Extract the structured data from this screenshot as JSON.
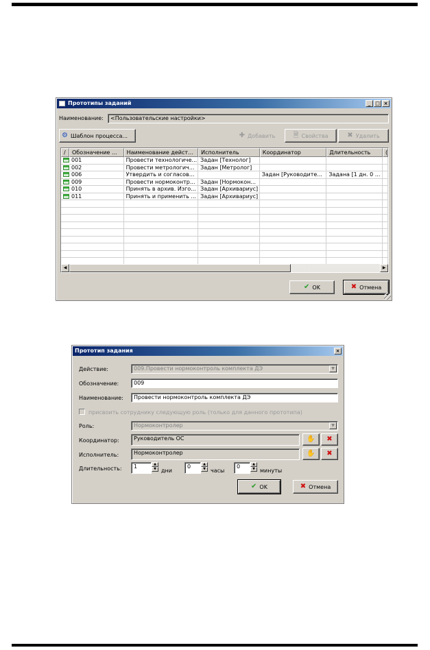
{
  "colors": {
    "titlebar_start": "#0a246a",
    "titlebar_end": "#a6caf0",
    "window_bg": "#d4d0c8",
    "ok_icon": "#2a9a2a",
    "cancel_icon": "#d01010"
  },
  "icons": [
    "window-icon",
    "process-icon",
    "add-icon",
    "properties-icon",
    "delete-icon",
    "table-row-icon",
    "ok-check-icon",
    "cancel-x-icon",
    "select-user-icon",
    "clear-x-icon"
  ],
  "win1": {
    "title": "Прототипы заданий",
    "name_label": "Наименование:",
    "name_value": "<Пользовательские настройки>",
    "toolbar": {
      "template": "Шаблон процесса...",
      "add": "Добавить",
      "props": "Свойства",
      "delete": "Удалить"
    },
    "columns": [
      "/",
      "Обозначение ...",
      "Наименование дейст...",
      "Исполнитель",
      "Координатор",
      "Длительность",
      "("
    ],
    "rows": [
      {
        "code": "001",
        "action": "Провести технологиче...",
        "executor": "Задан [Технолог]",
        "coord": "",
        "dur": ""
      },
      {
        "code": "002",
        "action": "Провести метрологич...",
        "executor": "Задан [Метролог]",
        "coord": "",
        "dur": ""
      },
      {
        "code": "006",
        "action": "Утвердить и согласов...",
        "executor": "",
        "coord": "Задан [Руководите...",
        "dur": "Задана [1 дн. 0 ..."
      },
      {
        "code": "009",
        "action": "Провести нормоконтр...",
        "executor": "Задан [Нормокон...",
        "coord": "",
        "dur": ""
      },
      {
        "code": "010",
        "action": "Принять в архив. Изго...",
        "executor": "Задан [Архивариус]",
        "coord": "",
        "dur": ""
      },
      {
        "code": "011",
        "action": "Принять и применить ...",
        "executor": "Задан [Архивариус]",
        "coord": "",
        "dur": ""
      }
    ],
    "ok": "OK",
    "cancel": "Отмена"
  },
  "win2": {
    "title": "Прототип задания",
    "action_label": "Действие:",
    "action_value": "009.Провести нормоконтроль комплекта ДЭ",
    "code_label": "Обозначение:",
    "code_value": "009",
    "name_label": "Наименование:",
    "name_value": "Провести нормоконтроль комплекта ДЭ",
    "assign_checkbox": "присвоить сотруднику следующую роль (только для данного прототипа)",
    "role_label": "Роль:",
    "role_value": "Нормоконтролер",
    "coord_label": "Координатор:",
    "coord_value": "Руководитель ОС",
    "exec_label": "Исполнитель:",
    "exec_value": "Нормоконтролер",
    "dur_label": "Длительность:",
    "days_value": "1",
    "days_unit": "дни",
    "hours_value": "0",
    "hours_unit": "часы",
    "minutes_value": "0",
    "minutes_unit": "минуты",
    "ok": "OK",
    "cancel": "Отмена"
  }
}
